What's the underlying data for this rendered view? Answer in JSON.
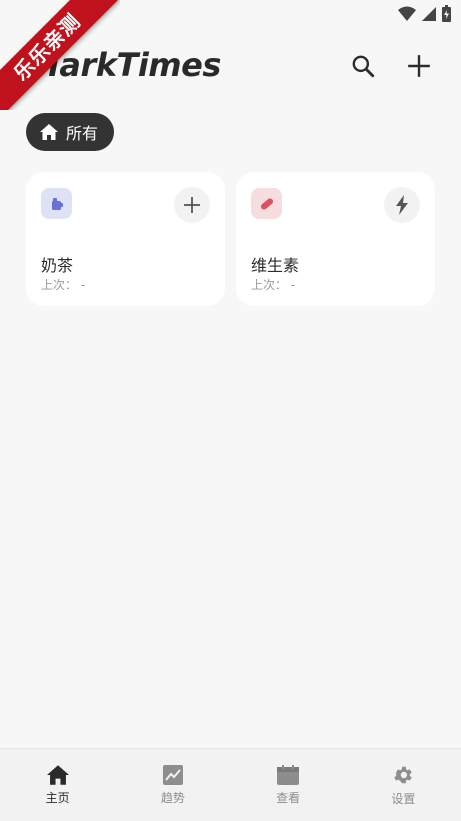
{
  "corner_banner": "乐乐亲测",
  "app": {
    "title": "MarkTimes"
  },
  "filter": {
    "label": "所有"
  },
  "cards": [
    {
      "name": "奶茶",
      "last": "上次： -",
      "icon_color": "#6b6fd8",
      "icon_bg": "#dfe1f7",
      "icon": "cup-icon",
      "action": "plus-icon"
    },
    {
      "name": "维生素",
      "last": "上次： -",
      "icon_color": "#d9535f",
      "icon_bg": "#f6dde0",
      "icon": "pill-icon",
      "action": "bolt-icon"
    }
  ],
  "nav": [
    {
      "label": "主页",
      "icon": "home-icon",
      "active": true
    },
    {
      "label": "趋势",
      "icon": "trend-icon",
      "active": false
    },
    {
      "label": "查看",
      "icon": "calendar-icon",
      "active": false
    },
    {
      "label": "设置",
      "icon": "gear-icon",
      "active": false
    }
  ],
  "colors": {
    "chip_bg": "#333333",
    "background": "#f7f7f7",
    "card_bg": "#ffffff"
  }
}
